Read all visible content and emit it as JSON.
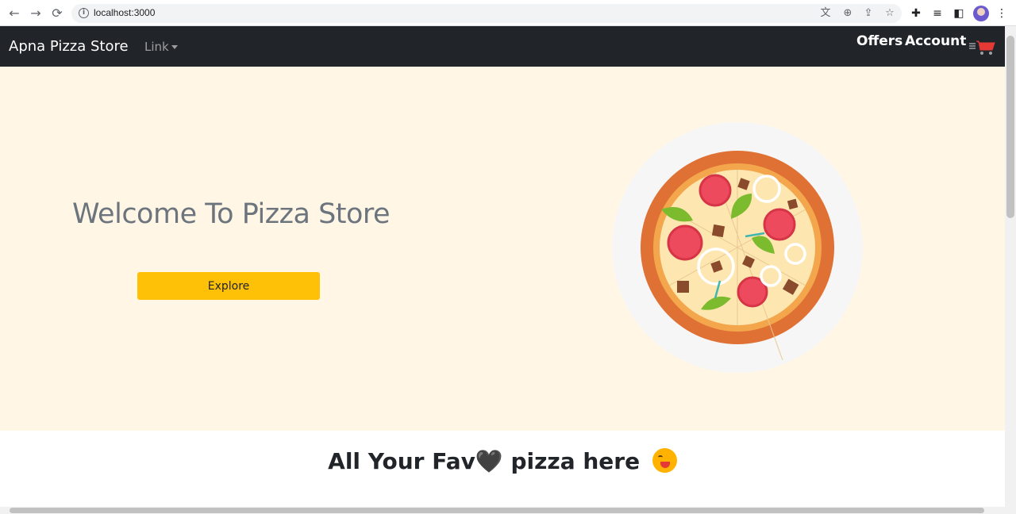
{
  "browser": {
    "url": "localhost:3000",
    "icons": [
      "back-icon",
      "forward-icon",
      "reload-icon",
      "info-icon",
      "translate-icon",
      "zoom-icon",
      "share-icon",
      "star-icon",
      "extensions-icon",
      "reading-list-icon",
      "side-panel-icon",
      "profile-avatar",
      "menu-icon"
    ]
  },
  "navbar": {
    "brand": "Apna Pizza Store",
    "link_dropdown": "Link",
    "offers": "Offers",
    "account": "Account"
  },
  "hero": {
    "title": "Welcome To Pizza Store",
    "explore_label": "Explore",
    "background": "#fff6e6",
    "button_color": "#ffc107"
  },
  "section": {
    "title_part1": "All Your Fav",
    "heart": "🖤",
    "title_part2": "pizza here"
  },
  "colors": {
    "navbar": "#212529",
    "muted_text": "#6c757d"
  }
}
